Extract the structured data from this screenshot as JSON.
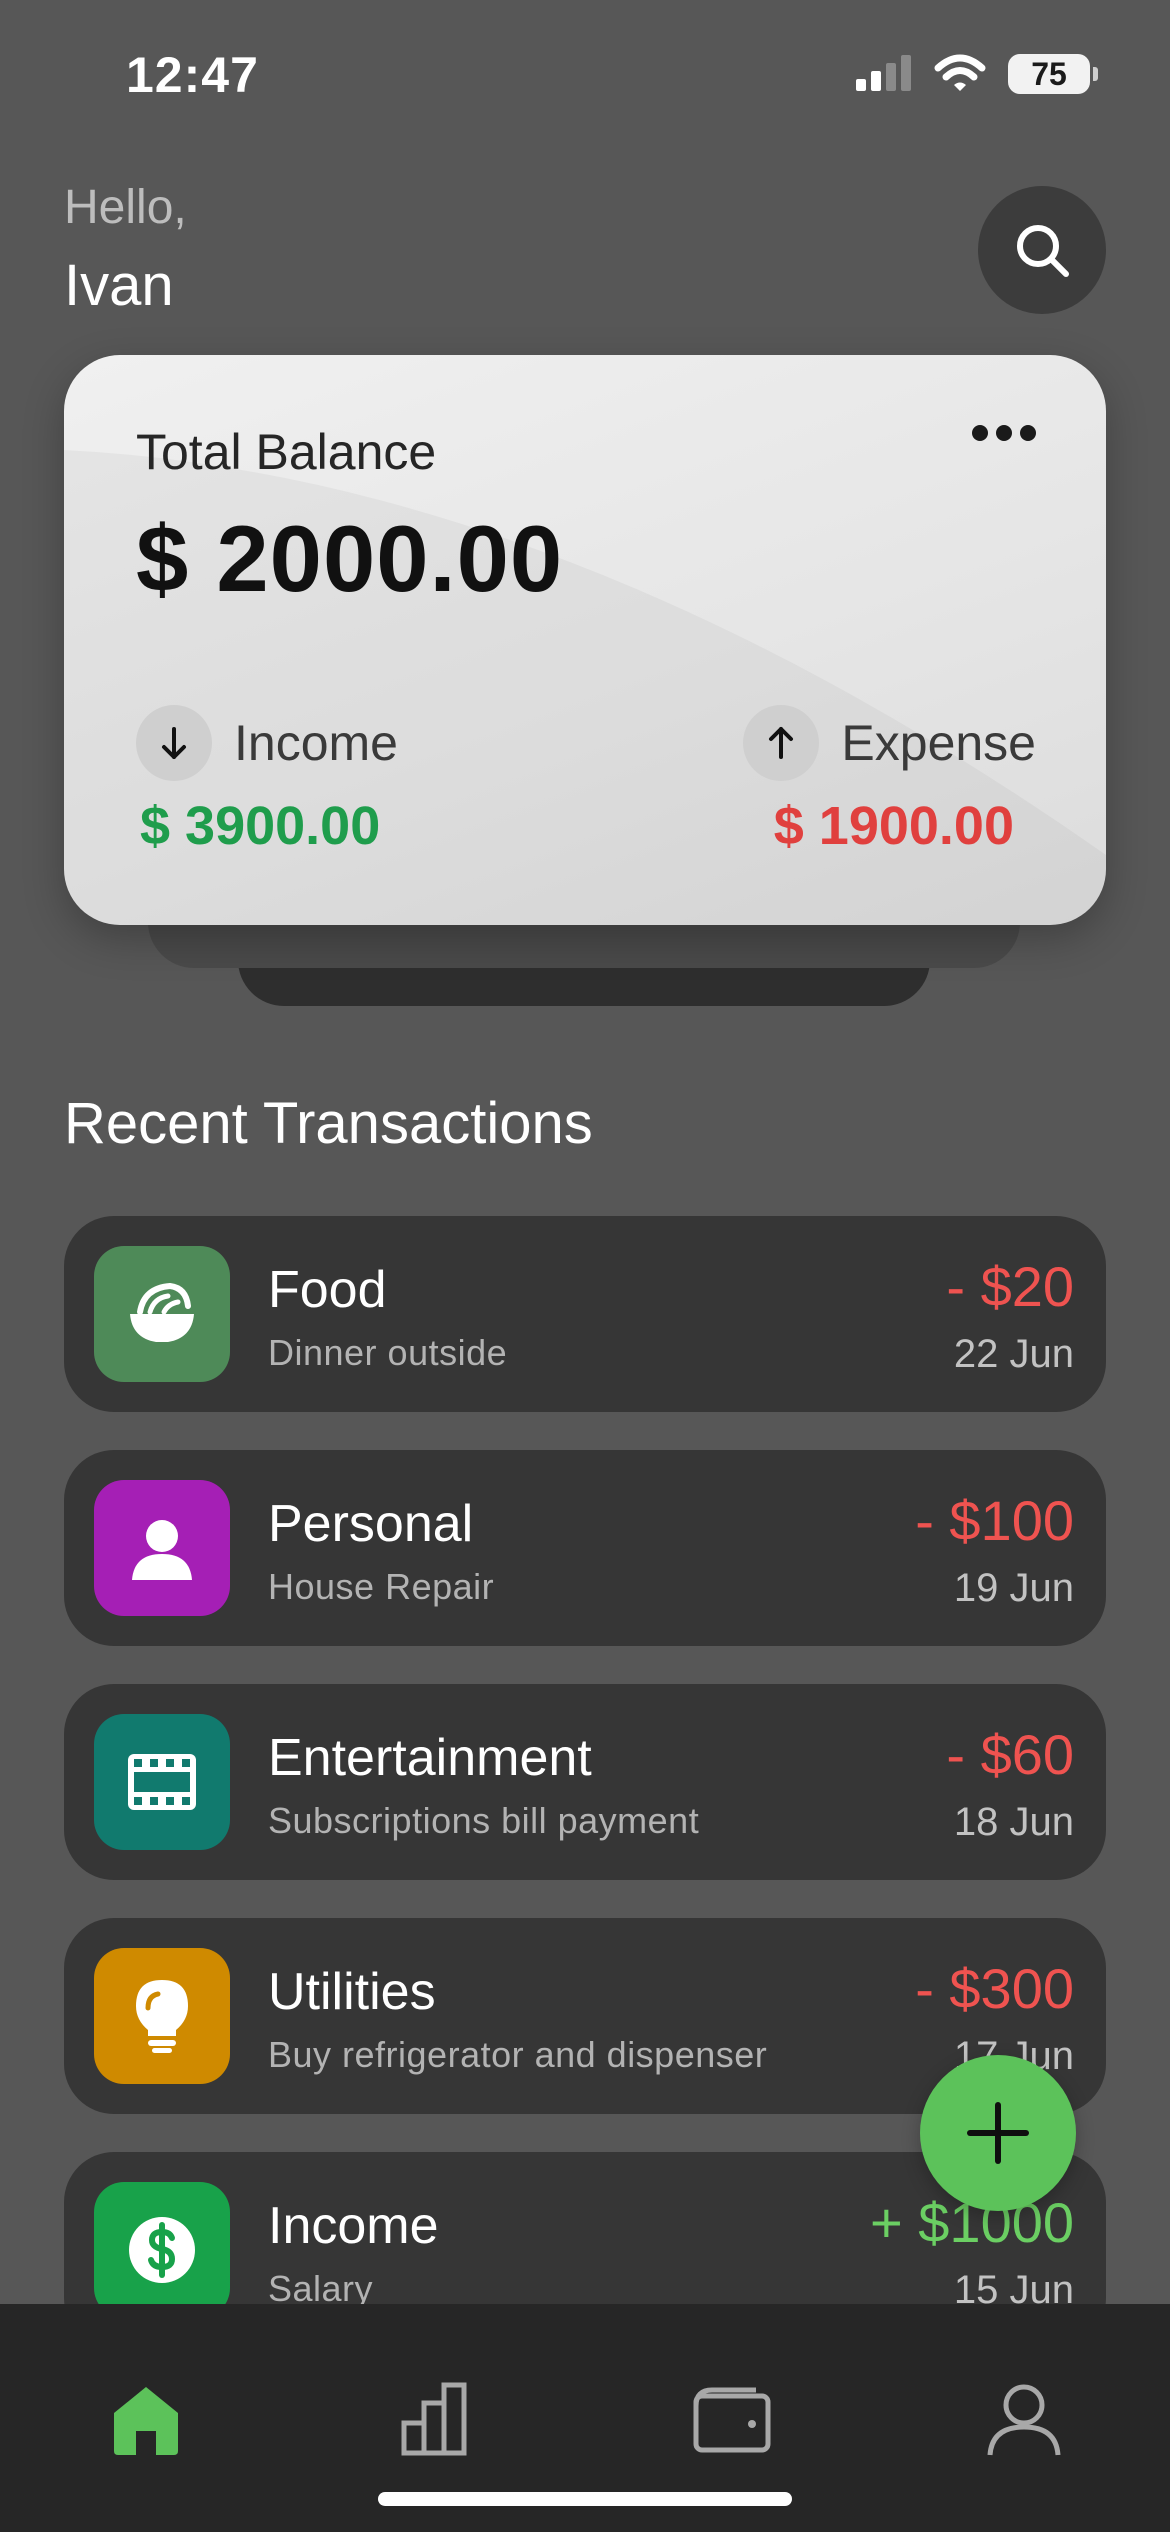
{
  "status_bar": {
    "time": "12:47",
    "battery": "75"
  },
  "greeting": {
    "hello": "Hello,",
    "name": "Ivan"
  },
  "balance_card": {
    "title": "Total Balance",
    "amount": "$ 2000.00",
    "income_label": "Income",
    "income_value": "$ 3900.00",
    "expense_label": "Expense",
    "expense_value": "$ 1900.00"
  },
  "section_title": "Recent Transactions",
  "transactions": [
    {
      "title": "Food",
      "subtitle": "Dinner outside",
      "amount": "- $20",
      "date": "22 Jun",
      "icon": "bowl-icon",
      "color": "#4e8a58",
      "amount_color": "#ef5350"
    },
    {
      "title": "Personal",
      "subtitle": "House Repair",
      "amount": "- $100",
      "date": "19 Jun",
      "icon": "person-icon",
      "color": "#a51fb5",
      "amount_color": "#ef5350"
    },
    {
      "title": "Entertainment",
      "subtitle": "Subscriptions bill payment",
      "amount": "- $60",
      "date": "18 Jun",
      "icon": "film-icon",
      "color": "#117a6e",
      "amount_color": "#ef5350"
    },
    {
      "title": "Utilities",
      "subtitle": "Buy refrigerator and dispenser",
      "amount": "- $300",
      "date": "17 Jun",
      "icon": "lightbulb-icon",
      "color": "#cf8a00",
      "amount_color": "#ef5350"
    },
    {
      "title": "Income",
      "subtitle": "Salary",
      "amount": "+ $1000",
      "date": "15 Jun",
      "icon": "dollar-icon",
      "color": "#18a24a",
      "amount_color": "#6bcf63"
    }
  ],
  "fab": {
    "icon": "plus-icon",
    "color": "#5cc25a"
  },
  "bottom_nav": [
    {
      "name": "home",
      "icon": "home-icon",
      "active": true
    },
    {
      "name": "stats",
      "icon": "bar-chart-icon",
      "active": false
    },
    {
      "name": "wallet",
      "icon": "wallet-icon",
      "active": false
    },
    {
      "name": "profile",
      "icon": "user-icon",
      "active": false
    }
  ],
  "colors": {
    "background": "#575757",
    "accent_green": "#5cc25a",
    "negative": "#ef5350",
    "positive": "#1f9d4c"
  }
}
